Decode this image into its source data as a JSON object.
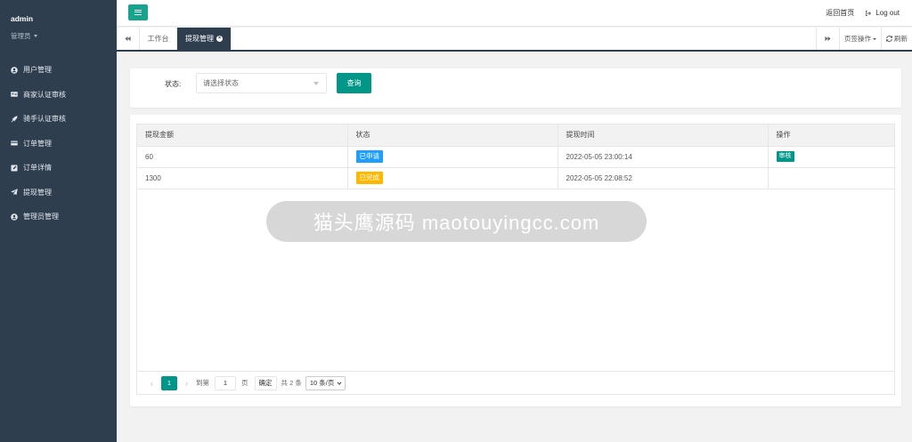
{
  "user": {
    "name": "admin",
    "role": "管理员"
  },
  "sidebar": {
    "items": [
      {
        "label": "用户管理",
        "icon": "user-circle-icon"
      },
      {
        "label": "商家认证审核",
        "icon": "id-card-icon"
      },
      {
        "label": "骑手认证审核",
        "icon": "rocket-icon"
      },
      {
        "label": "订单管理",
        "icon": "credit-card-icon"
      },
      {
        "label": "订单详情",
        "icon": "edit-icon"
      },
      {
        "label": "提现管理",
        "icon": "paper-plane-icon"
      },
      {
        "label": "管理员管理",
        "icon": "user-icon"
      }
    ]
  },
  "header": {
    "home_link": "返回首页",
    "logout": "Log out"
  },
  "tabs": {
    "home": "工作台",
    "active": "提现管理",
    "page_ops": "页签操作",
    "refresh": "刷新"
  },
  "filter": {
    "status_label": "状态:",
    "status_placeholder": "请选择状态",
    "query_button": "查询"
  },
  "table": {
    "columns": [
      "提现金额",
      "状态",
      "提现时间",
      "操作"
    ],
    "rows": [
      {
        "amount": "60",
        "status": "已申请",
        "time": "2022-05-05 23:00:14",
        "action": "审核"
      },
      {
        "amount": "1300",
        "status": "已完成",
        "time": "2022-05-05 22:08:52",
        "action": ""
      }
    ]
  },
  "pager": {
    "current": "1",
    "goto_label": "到第",
    "goto_value": "1",
    "page_unit": "页",
    "confirm": "确定",
    "total": "共 2 条",
    "page_size": "10 条/页"
  },
  "watermark": "猫头鹰源码 maotouyingcc.com",
  "colors": {
    "sidebar": "#2f3e4e",
    "primary": "#009688",
    "blue": "#1e9fff",
    "yellow": "#ffb800"
  }
}
